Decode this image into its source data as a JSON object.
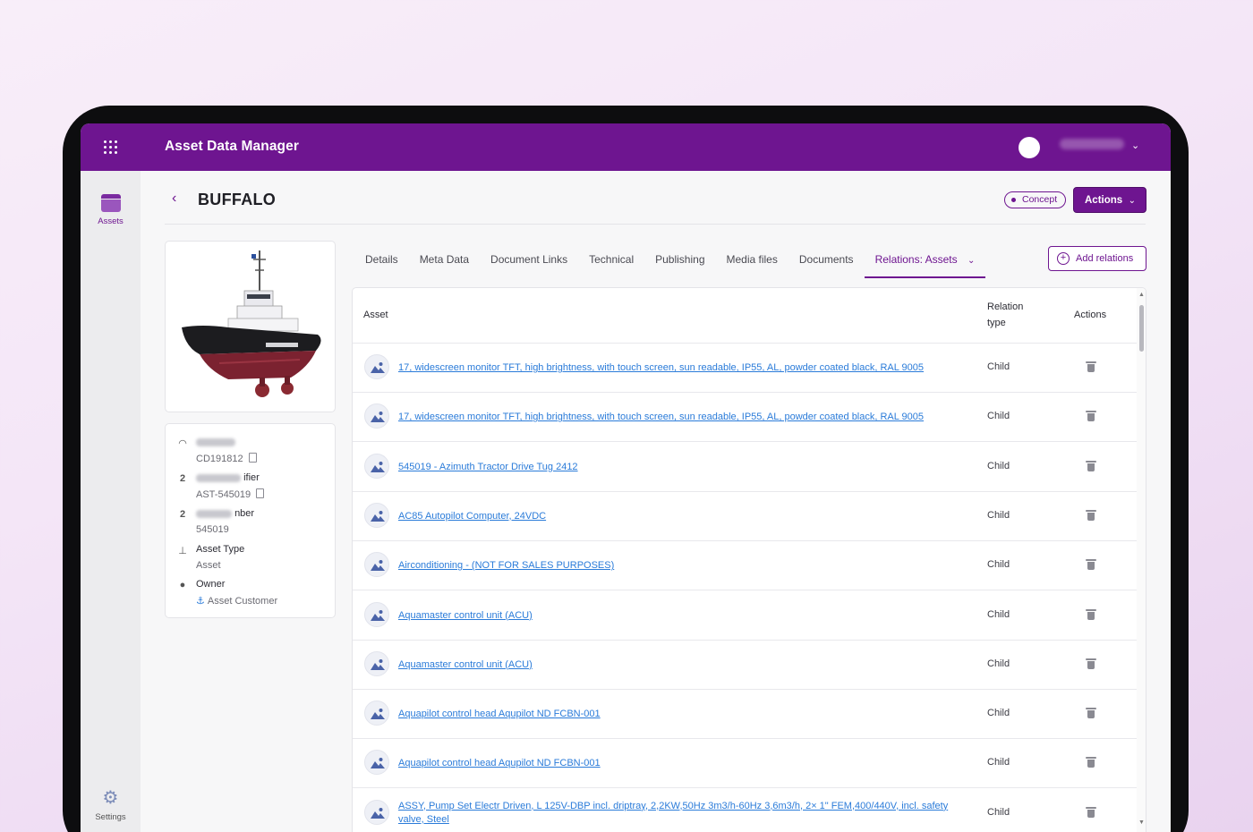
{
  "app": {
    "title": "Asset Data Manager"
  },
  "sidebar": {
    "items": [
      {
        "label": "Assets",
        "icon": "box-icon"
      },
      {
        "label": "Settings",
        "icon": "gear-icon"
      }
    ]
  },
  "header": {
    "title": "BUFFALO",
    "status": "Concept",
    "actions_label": "Actions"
  },
  "info": {
    "code": "CD191812",
    "identifier_suffix": "ifier",
    "identifier_value": "AST-545019",
    "number_suffix": "nber",
    "number_value": "545019",
    "asset_type_label": "Asset Type",
    "asset_type_value": "Asset",
    "owner_label": "Owner",
    "owner_value": "Asset Customer"
  },
  "tabs": [
    "Details",
    "Meta Data",
    "Document Links",
    "Technical",
    "Publishing",
    "Media files",
    "Documents",
    "Relations: Assets"
  ],
  "add_relations_label": "Add relations",
  "table": {
    "headers": {
      "asset": "Asset",
      "relation_type_1": "Relation",
      "relation_type_2": "type",
      "actions": "Actions"
    },
    "rows": [
      {
        "asset": "17, widescreen monitor TFT, high brightness, with touch screen, sun readable, IP55, AL, powder coated black, RAL 9005",
        "relation": "Child"
      },
      {
        "asset": "17, widescreen monitor TFT, high brightness, with touch screen, sun readable, IP55, AL, powder coated black, RAL 9005",
        "relation": "Child"
      },
      {
        "asset": "545019 - Azimuth Tractor Drive Tug 2412",
        "relation": "Child"
      },
      {
        "asset": "AC85 Autopilot Computer, 24VDC",
        "relation": "Child"
      },
      {
        "asset": "Airconditioning - (NOT FOR SALES PURPOSES)",
        "relation": "Child"
      },
      {
        "asset": "Aquamaster control unit (ACU)",
        "relation": "Child"
      },
      {
        "asset": "Aquamaster control unit (ACU)",
        "relation": "Child"
      },
      {
        "asset": "Aquapilot control head Aqupilot ND FCBN-001",
        "relation": "Child"
      },
      {
        "asset": "Aquapilot control head Aqupilot ND FCBN-001",
        "relation": "Child"
      },
      {
        "asset": "ASSY, Pump Set Electr Driven, L 125V-DBP incl. driptray, 2,2KW,50Hz 3m3/h-60Hz 3,6m3/h, 2× 1\" FEM,400/440V, incl. safety valve, Steel",
        "relation": "Child"
      }
    ]
  },
  "colors": {
    "brand": "#6e1590",
    "link": "#2a7bd9"
  }
}
